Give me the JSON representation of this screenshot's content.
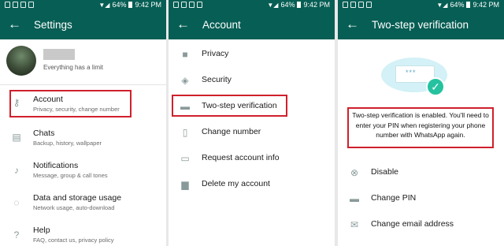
{
  "statusbar": {
    "battery": "64%",
    "time": "9:42 PM"
  },
  "panel1": {
    "title": "Settings",
    "profile_status": "Everything has a limit",
    "items": [
      {
        "label": "Account",
        "sub": "Privacy, security, change number"
      },
      {
        "label": "Chats",
        "sub": "Backup, history, wallpaper"
      },
      {
        "label": "Notifications",
        "sub": "Message, group & call tones"
      },
      {
        "label": "Data and storage usage",
        "sub": "Network usage, auto-download"
      },
      {
        "label": "Help",
        "sub": "FAQ, contact us, privacy policy"
      }
    ]
  },
  "panel2": {
    "title": "Account",
    "items": [
      {
        "label": "Privacy"
      },
      {
        "label": "Security"
      },
      {
        "label": "Two-step verification"
      },
      {
        "label": "Change number"
      },
      {
        "label": "Request account info"
      },
      {
        "label": "Delete my account"
      }
    ]
  },
  "panel3": {
    "title": "Two-step verification",
    "pin_glyph": "***",
    "message": "Two-step verification is enabled. You'll need to enter your PIN when registering your phone number with WhatsApp again.",
    "items": [
      {
        "label": "Disable"
      },
      {
        "label": "Change PIN"
      },
      {
        "label": "Change email address"
      }
    ]
  },
  "colors": {
    "header": "#075e54",
    "highlight": "#d0202c",
    "accent": "#25c2a0"
  }
}
